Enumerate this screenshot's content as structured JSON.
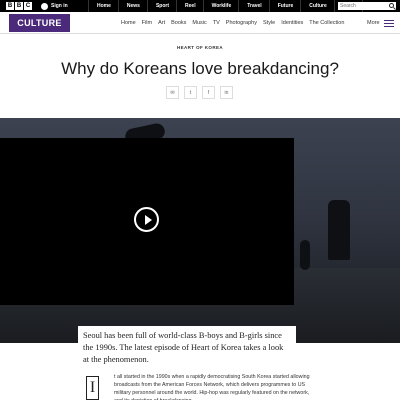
{
  "global_nav": {
    "logo_letters": [
      "B",
      "B",
      "C"
    ],
    "signin": "Sign in",
    "items": [
      "Home",
      "News",
      "Sport",
      "Reel",
      "Worklife",
      "Travel",
      "Future",
      "Culture",
      "More"
    ],
    "more_chevron": "▾",
    "search_placeholder": "Search"
  },
  "section": {
    "badge": "CULTURE",
    "nav": [
      "Home",
      "Film",
      "Art",
      "Books",
      "Music",
      "TV",
      "Photography",
      "Style",
      "Identities",
      "The Collection"
    ],
    "more": "More",
    "accent_color": "#4b2a7b"
  },
  "article": {
    "kicker": "HEART OF KOREA",
    "headline": "Why do Koreans love breakdancing?",
    "share_icons": [
      "✉",
      "t",
      "f",
      "in"
    ],
    "intro": "Seoul has been full of world-class B-boys and B-girls since the 1990s. The latest episode of Heart of Korea takes a look at the phenomenon.",
    "dropcap": "I",
    "body": "t all started in the 1990s when a rapidly democratising South Korea started allowing broadcasts from the American Forces Network, which delivers programmes to US military personnel around the world. Hip-hop was regularly featured on the network, and its depiction of breakdancing"
  }
}
